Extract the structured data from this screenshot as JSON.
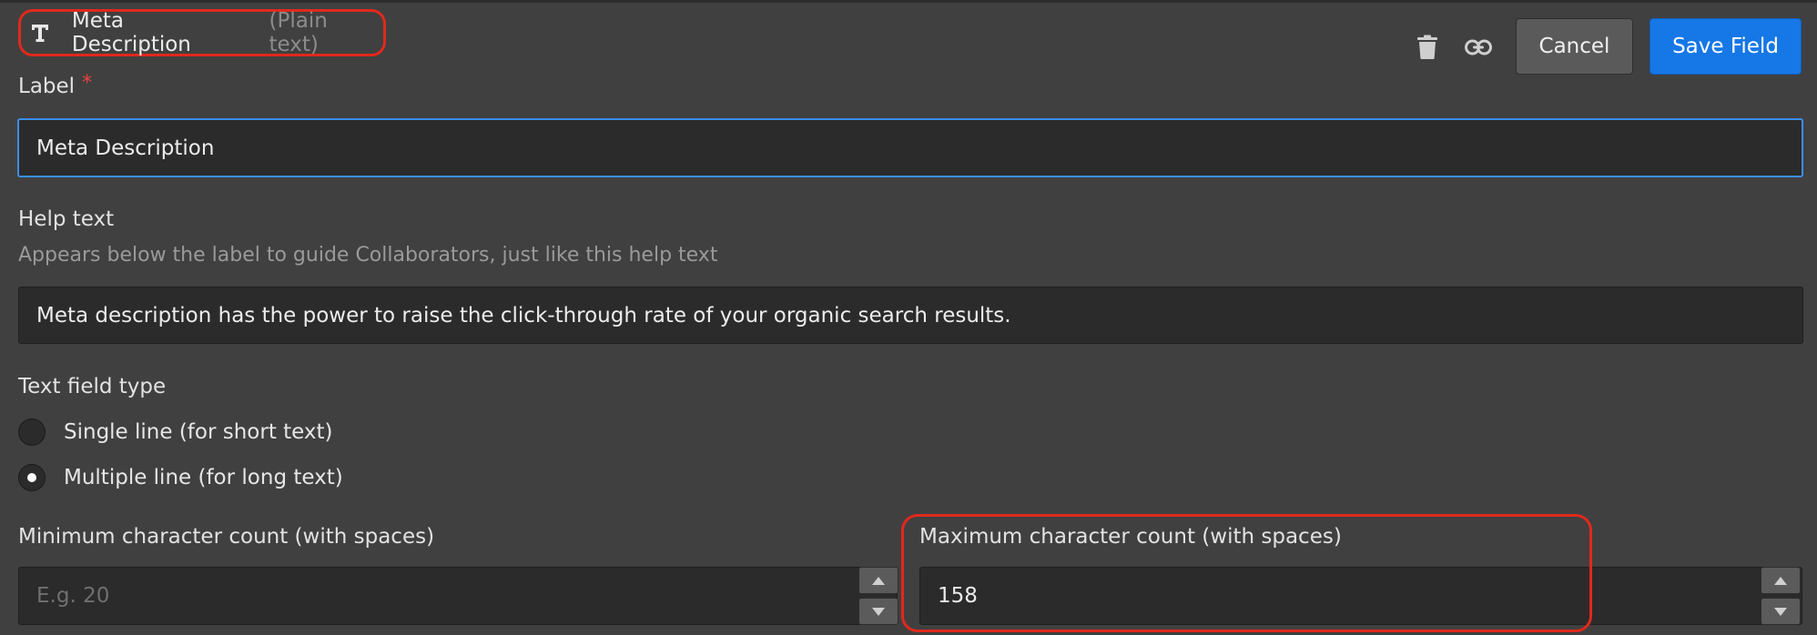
{
  "header": {
    "field_title": "Meta Description",
    "field_type": "(Plain text)",
    "type_icon": "text-t-icon",
    "delete_icon": "trash-icon",
    "link_icon": "link-icon",
    "cancel_label": "Cancel",
    "save_label": "Save Field"
  },
  "label_section": {
    "label": "Label",
    "required_mark": "*",
    "value": "Meta Description"
  },
  "help_section": {
    "label": "Help text",
    "hint": "Appears below the label to guide Collaborators, just like this help text",
    "value": "Meta description has the power to raise the click-through rate of your organic search results."
  },
  "text_field_type": {
    "label": "Text field type",
    "options": [
      {
        "label": "Single line (for short text)",
        "selected": false
      },
      {
        "label": "Multiple line (for long text)",
        "selected": true
      }
    ]
  },
  "min_count": {
    "label": "Minimum character count (with spaces)",
    "placeholder": "E.g. 20",
    "value": ""
  },
  "max_count": {
    "label": "Maximum character count (with spaces)",
    "value": "158"
  },
  "colors": {
    "background": "#404040",
    "input_bg": "#2b2b2b",
    "accent_blue": "#1677e6",
    "focus_border": "#3b8ff0",
    "highlight_red": "#e0291c",
    "required_red": "#e9423d"
  }
}
